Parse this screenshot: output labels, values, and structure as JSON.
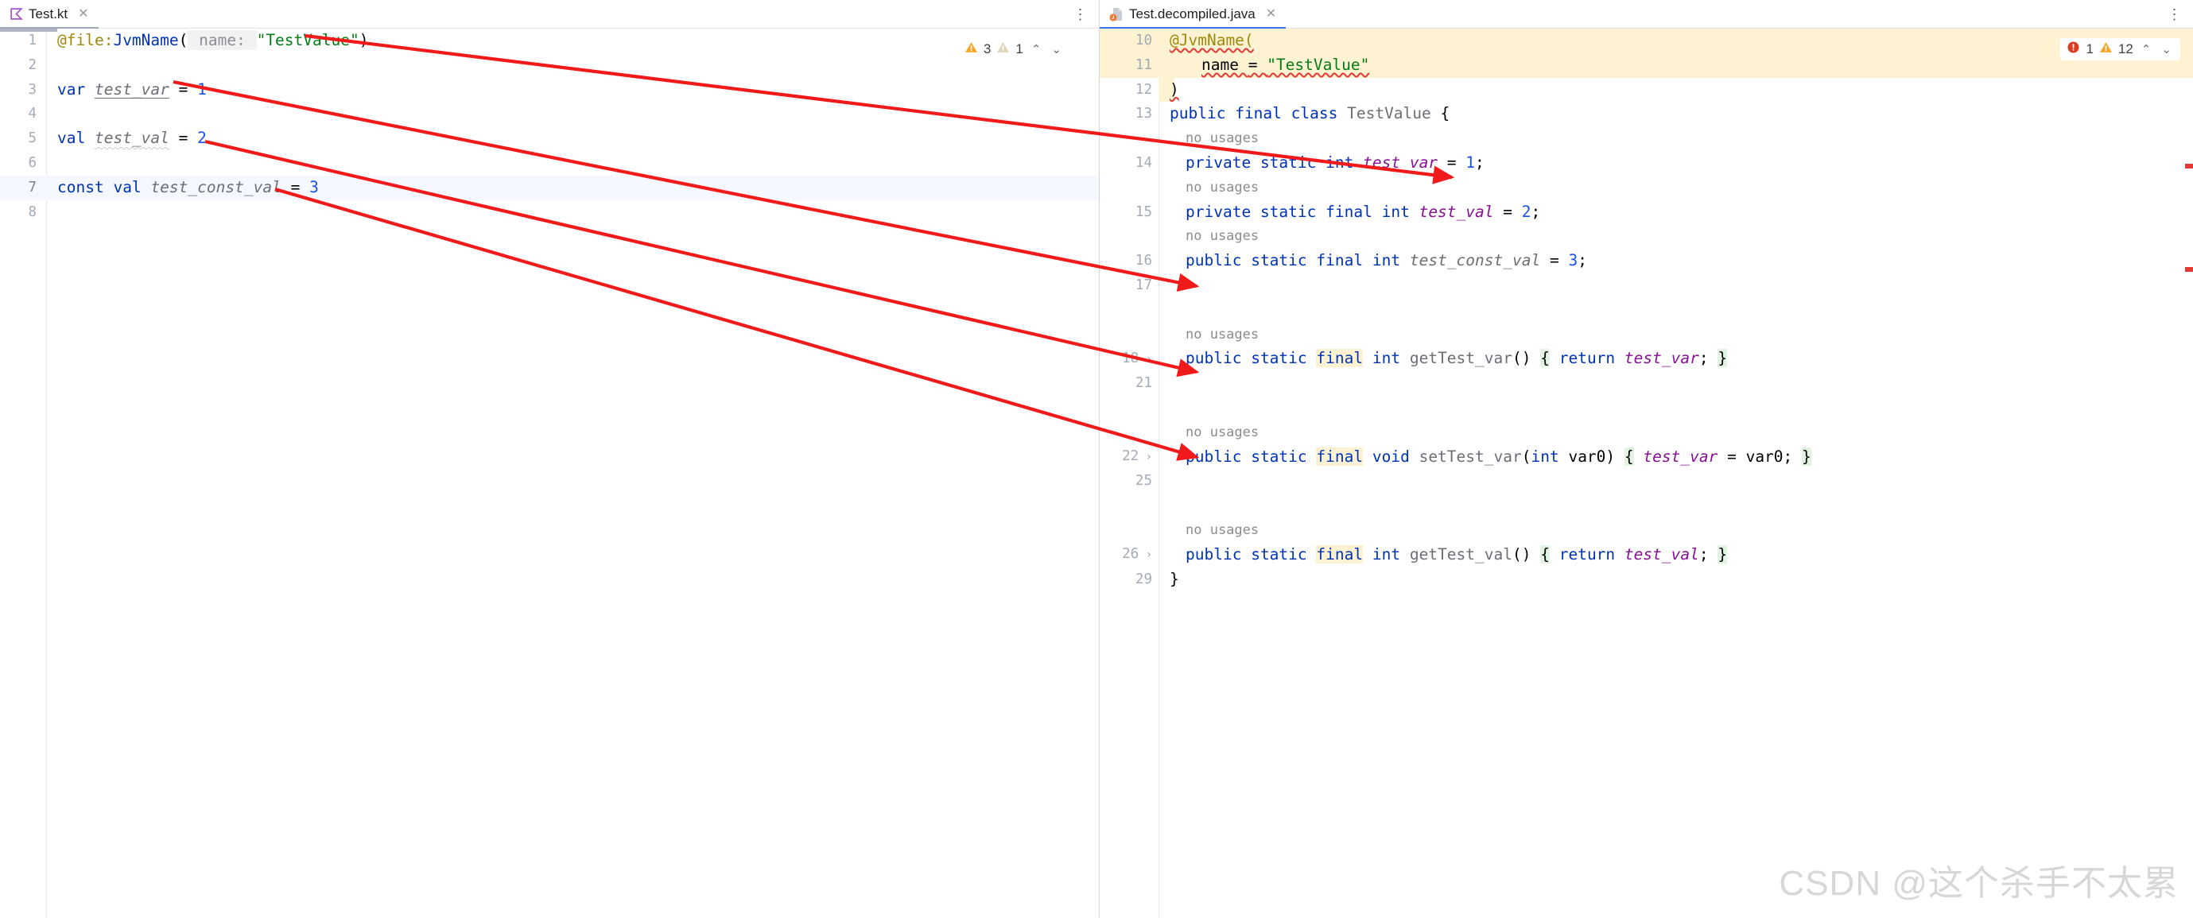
{
  "left_pane": {
    "tab": {
      "label": "Test.kt",
      "icon": "kotlin-file-icon",
      "close_icon": "close-icon",
      "active": true
    },
    "options_icon": "more-options-icon",
    "inspection": {
      "warning_icon": "warning-triangle-icon",
      "warning_count": "3",
      "weak_warning_icon": "weak-warning-triangle-icon",
      "weak_warning_count": "1",
      "prev_icon": "chevron-up-icon",
      "next_icon": "chevron-down-icon"
    },
    "lines": [
      {
        "n": "1",
        "tokens": [
          {
            "t": "@file:",
            "c": "k-anno"
          },
          {
            "t": "JvmName",
            "c": "k-annoid"
          },
          {
            "t": "(",
            "c": "k-paren"
          },
          {
            "t": " name: ",
            "c": "k-param"
          },
          {
            "t": "\"TestValue\"",
            "c": "k-str"
          },
          {
            "t": ")",
            "c": "k-paren"
          }
        ]
      },
      {
        "n": "2",
        "tokens": []
      },
      {
        "n": "3",
        "tokens": [
          {
            "t": "var",
            "c": "k-kw"
          },
          {
            "t": " ",
            "c": "k-op"
          },
          {
            "t": "test_var",
            "c": "k-ident u"
          },
          {
            "t": " ",
            "c": "k-op"
          },
          {
            "t": "=",
            "c": "k-op"
          },
          {
            "t": " ",
            "c": "k-op"
          },
          {
            "t": "1",
            "c": "k-num"
          }
        ]
      },
      {
        "n": "4",
        "tokens": []
      },
      {
        "n": "5",
        "tokens": [
          {
            "t": "val",
            "c": "k-kw"
          },
          {
            "t": " ",
            "c": "k-op"
          },
          {
            "t": "test_val",
            "c": "k-ident squiggle"
          },
          {
            "t": " ",
            "c": "k-op"
          },
          {
            "t": "=",
            "c": "k-op"
          },
          {
            "t": " ",
            "c": "k-op"
          },
          {
            "t": "2",
            "c": "k-num"
          }
        ]
      },
      {
        "n": "6",
        "tokens": []
      },
      {
        "n": "7",
        "current": true,
        "tokens": [
          {
            "t": "const",
            "c": "k-kw"
          },
          {
            "t": " ",
            "c": "k-op"
          },
          {
            "t": "val",
            "c": "k-kw"
          },
          {
            "t": " ",
            "c": "k-op"
          },
          {
            "t": "test_const_val",
            "c": "k-ident"
          },
          {
            "t": " ",
            "c": "k-op"
          },
          {
            "t": "=",
            "c": "k-op"
          },
          {
            "t": " ",
            "c": "k-op"
          },
          {
            "t": "3",
            "c": "k-num"
          }
        ]
      },
      {
        "n": "8",
        "tokens": []
      }
    ]
  },
  "right_pane": {
    "tab": {
      "label": "Test.decompiled.java",
      "icon": "java-decompiled-file-icon",
      "close_icon": "close-icon",
      "active": true
    },
    "options_icon": "more-options-icon",
    "inspection": {
      "error_icon": "error-circle-icon",
      "error_count": "1",
      "warning_icon": "warning-triangle-icon",
      "warning_count": "12",
      "prev_icon": "chevron-up-icon",
      "next_icon": "chevron-down-icon"
    },
    "lines": [
      {
        "n": "10",
        "band": true,
        "tokens": [
          {
            "t": "@JvmName(",
            "c": "j-anno err-squig"
          }
        ]
      },
      {
        "n": "11",
        "band": true,
        "indent": 2,
        "tokens": [
          {
            "t": "name ",
            "c": "j-op err-squig"
          },
          {
            "t": "= ",
            "c": "j-op err-squig"
          },
          {
            "t": "\"TestValue\"",
            "c": "j-str err-squig"
          }
        ]
      },
      {
        "n": "12",
        "bandsmall": true,
        "tokens": [
          {
            "t": ")",
            "c": "j-op err-squig"
          }
        ]
      },
      {
        "n": "13",
        "tokens": [
          {
            "t": "public",
            "c": "j-kw"
          },
          {
            "t": " ",
            "c": "j-op"
          },
          {
            "t": "final",
            "c": "j-kw"
          },
          {
            "t": " ",
            "c": "j-op"
          },
          {
            "t": "class",
            "c": "j-kw"
          },
          {
            "t": " ",
            "c": "j-op"
          },
          {
            "t": "TestValue",
            "c": "j-type"
          },
          {
            "t": " {",
            "c": "j-op"
          }
        ]
      },
      {
        "hint": "no usages"
      },
      {
        "n": "14",
        "indent": 1,
        "tokens": [
          {
            "t": "private",
            "c": "j-kw"
          },
          {
            "t": " ",
            "c": "j-op"
          },
          {
            "t": "static",
            "c": "j-kw"
          },
          {
            "t": " ",
            "c": "j-op"
          },
          {
            "t": "int",
            "c": "j-kw"
          },
          {
            "t": " ",
            "c": "j-op"
          },
          {
            "t": "test_var",
            "c": "j-field"
          },
          {
            "t": " = ",
            "c": "j-op"
          },
          {
            "t": "1",
            "c": "j-num"
          },
          {
            "t": ";",
            "c": "j-op"
          }
        ]
      },
      {
        "hint": "no usages"
      },
      {
        "n": "15",
        "indent": 1,
        "tokens": [
          {
            "t": "private",
            "c": "j-kw"
          },
          {
            "t": " ",
            "c": "j-op"
          },
          {
            "t": "static",
            "c": "j-kw"
          },
          {
            "t": " ",
            "c": "j-op"
          },
          {
            "t": "final",
            "c": "j-kw"
          },
          {
            "t": " ",
            "c": "j-op"
          },
          {
            "t": "int",
            "c": "j-kw"
          },
          {
            "t": " ",
            "c": "j-op"
          },
          {
            "t": "test_val",
            "c": "j-field"
          },
          {
            "t": " = ",
            "c": "j-op"
          },
          {
            "t": "2",
            "c": "j-num"
          },
          {
            "t": ";",
            "c": "j-op"
          }
        ]
      },
      {
        "hint": "no usages"
      },
      {
        "n": "16",
        "indent": 1,
        "tokens": [
          {
            "t": "public",
            "c": "j-kw"
          },
          {
            "t": " ",
            "c": "j-op"
          },
          {
            "t": "static",
            "c": "j-kw"
          },
          {
            "t": " ",
            "c": "j-op"
          },
          {
            "t": "final",
            "c": "j-kw"
          },
          {
            "t": " ",
            "c": "j-op"
          },
          {
            "t": "int",
            "c": "j-kw"
          },
          {
            "t": " ",
            "c": "j-op"
          },
          {
            "t": "test_const_val",
            "c": "j-const"
          },
          {
            "t": " = ",
            "c": "j-op"
          },
          {
            "t": "3",
            "c": "j-num"
          },
          {
            "t": ";",
            "c": "j-op"
          }
        ]
      },
      {
        "n": "17",
        "tokens": []
      },
      {
        "spacer": true
      },
      {
        "hint": "no usages"
      },
      {
        "n": "18",
        "fold": true,
        "indent": 1,
        "tokens": [
          {
            "t": "public",
            "c": "j-kw"
          },
          {
            "t": " ",
            "c": "j-op"
          },
          {
            "t": "static",
            "c": "j-kw"
          },
          {
            "t": " ",
            "c": "j-op"
          },
          {
            "t": "final",
            "c": "j-kw hl-yellow"
          },
          {
            "t": " ",
            "c": "j-op"
          },
          {
            "t": "int",
            "c": "j-kw"
          },
          {
            "t": " ",
            "c": "j-op"
          },
          {
            "t": "getTest_var",
            "c": "j-meth"
          },
          {
            "t": "()",
            "c": "j-paren"
          },
          {
            "t": " ",
            "c": "j-op"
          },
          {
            "t": "{",
            "c": "j-op hl-green"
          },
          {
            "t": " ",
            "c": "j-op"
          },
          {
            "t": "return",
            "c": "j-kw"
          },
          {
            "t": " ",
            "c": "j-op"
          },
          {
            "t": "test_var",
            "c": "j-field"
          },
          {
            "t": ";",
            "c": "j-op"
          },
          {
            "t": " ",
            "c": "j-op"
          },
          {
            "t": "}",
            "c": "j-op hl-green"
          }
        ]
      },
      {
        "n": "21",
        "tokens": []
      },
      {
        "spacer": true
      },
      {
        "hint": "no usages"
      },
      {
        "n": "22",
        "fold": true,
        "indent": 1,
        "tokens": [
          {
            "t": "public",
            "c": "j-kw"
          },
          {
            "t": " ",
            "c": "j-op"
          },
          {
            "t": "static",
            "c": "j-kw"
          },
          {
            "t": " ",
            "c": "j-op"
          },
          {
            "t": "final",
            "c": "j-kw hl-yellow"
          },
          {
            "t": " ",
            "c": "j-op"
          },
          {
            "t": "void",
            "c": "j-kw"
          },
          {
            "t": " ",
            "c": "j-op"
          },
          {
            "t": "setTest_var",
            "c": "j-meth"
          },
          {
            "t": "(",
            "c": "j-paren"
          },
          {
            "t": "int",
            "c": "j-kw"
          },
          {
            "t": " ",
            "c": "j-op"
          },
          {
            "t": "var0",
            "c": "j-op"
          },
          {
            "t": ")",
            "c": "j-paren"
          },
          {
            "t": " ",
            "c": "j-op"
          },
          {
            "t": "{",
            "c": "j-op hl-green"
          },
          {
            "t": " ",
            "c": "j-op"
          },
          {
            "t": "test_var",
            "c": "j-field"
          },
          {
            "t": " = ",
            "c": "j-op"
          },
          {
            "t": "var0",
            "c": "j-op"
          },
          {
            "t": ";",
            "c": "j-op"
          },
          {
            "t": " ",
            "c": "j-op"
          },
          {
            "t": "}",
            "c": "j-op hl-green"
          }
        ]
      },
      {
        "n": "25",
        "tokens": []
      },
      {
        "spacer": true
      },
      {
        "hint": "no usages"
      },
      {
        "n": "26",
        "fold": true,
        "indent": 1,
        "tokens": [
          {
            "t": "public",
            "c": "j-kw"
          },
          {
            "t": " ",
            "c": "j-op"
          },
          {
            "t": "static",
            "c": "j-kw"
          },
          {
            "t": " ",
            "c": "j-op"
          },
          {
            "t": "final",
            "c": "j-kw hl-yellow"
          },
          {
            "t": " ",
            "c": "j-op"
          },
          {
            "t": "int",
            "c": "j-kw"
          },
          {
            "t": " ",
            "c": "j-op"
          },
          {
            "t": "getTest_val",
            "c": "j-meth"
          },
          {
            "t": "()",
            "c": "j-paren"
          },
          {
            "t": " ",
            "c": "j-op"
          },
          {
            "t": "{",
            "c": "j-op hl-green"
          },
          {
            "t": " ",
            "c": "j-op"
          },
          {
            "t": "return",
            "c": "j-kw"
          },
          {
            "t": " ",
            "c": "j-op"
          },
          {
            "t": "test_val",
            "c": "j-field"
          },
          {
            "t": ";",
            "c": "j-op"
          },
          {
            "t": " ",
            "c": "j-op"
          },
          {
            "t": "}",
            "c": "j-op hl-green"
          }
        ]
      },
      {
        "n": "29",
        "tokens": [
          {
            "t": "}",
            "c": "j-op"
          }
        ]
      }
    ]
  },
  "annotation_arrows": {
    "color": "#f01a1a",
    "count": 4,
    "description": "red arrows mapping kotlin declarations to decompiled java members"
  },
  "watermark": "CSDN @这个杀手不太累",
  "colors": {
    "accent_tab_underline": "#3574f0",
    "arrow_red": "#f01a1a",
    "annotation_band": "#fdf3d2",
    "keyword_blue": "#0033b3",
    "string_green": "#067d17",
    "field_purple": "#871094",
    "number_blue": "#1750eb",
    "current_line": "#f5f8ff",
    "error_red": "#e53935",
    "warning_amber": "#f5a623"
  }
}
